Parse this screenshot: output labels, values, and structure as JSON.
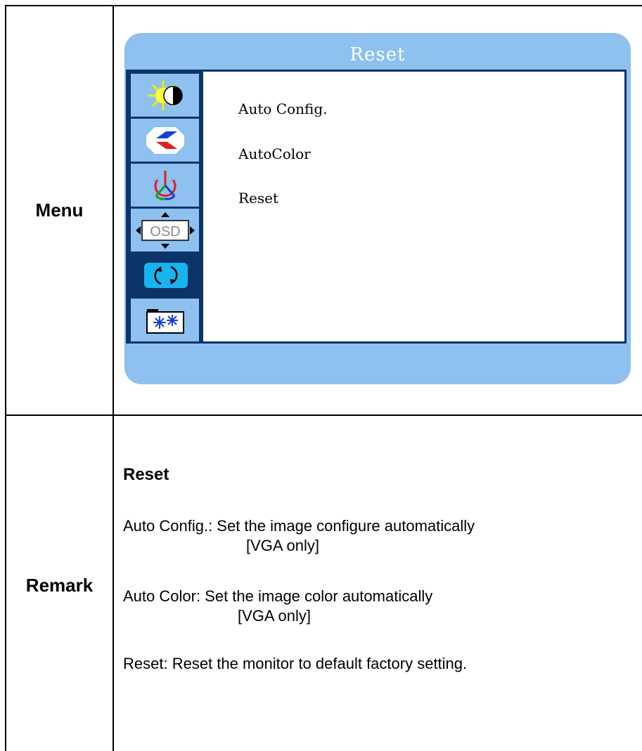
{
  "table": {
    "menu_label": "Menu",
    "remark_label": "Remark"
  },
  "osd": {
    "title": "Reset",
    "options": [
      "Auto Config.",
      "AutoColor",
      "Reset"
    ],
    "sidebar_icons": [
      {
        "name": "brightness-contrast-icon",
        "active": false
      },
      {
        "name": "image-setup-icon",
        "active": false
      },
      {
        "name": "color-temperature-icon",
        "active": false
      },
      {
        "name": "osd-settings-icon",
        "active": false
      },
      {
        "name": "reset-icon",
        "active": true
      },
      {
        "name": "misc-settings-icon",
        "active": false
      }
    ],
    "osd_icon_text": "OSD",
    "colors": {
      "frame": "#8ec0f0",
      "dark": "#0b3468",
      "active_icon": "#18b4ee"
    }
  },
  "remark": {
    "heading": "Reset",
    "auto_config": "Auto Config.: Set the image configure automatically",
    "auto_config_note": "[VGA only]",
    "auto_color": "Auto Color: Set the image color automatically",
    "auto_color_note": "[VGA only]",
    "reset": "Reset: Reset the monitor to default factory setting."
  }
}
